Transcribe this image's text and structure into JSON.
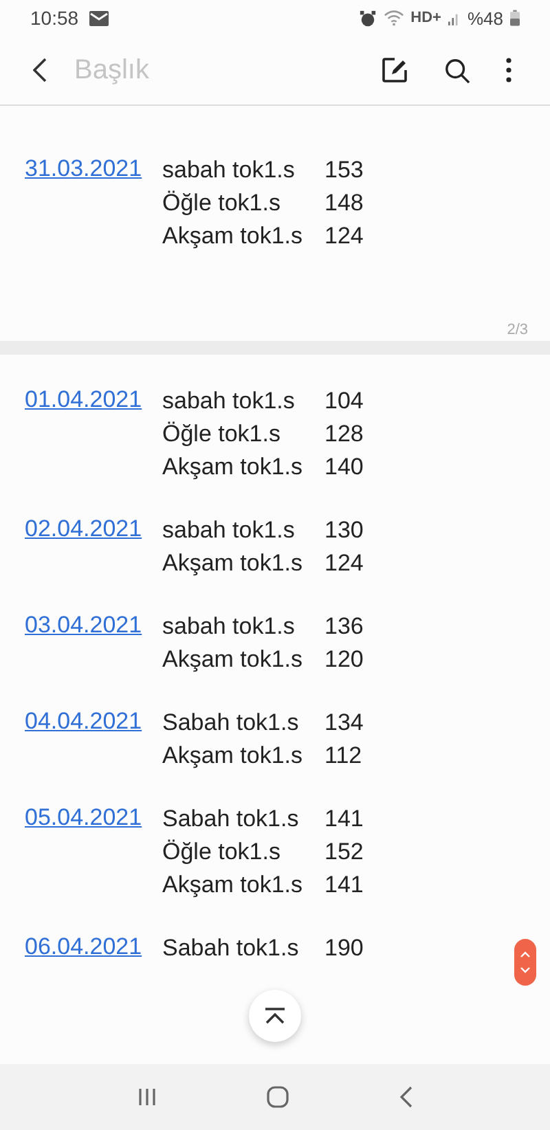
{
  "status_bar": {
    "time": "10:58",
    "network": "HD+",
    "battery": "%48"
  },
  "toolbar": {
    "title_placeholder": "Başlık"
  },
  "pages": [
    {
      "page_number": "2/3",
      "entries": [
        {
          "date": "31.03.2021",
          "lines": [
            {
              "label": "sabah tok1.s",
              "value": "153"
            },
            {
              "label": "Öğle tok1.s",
              "value": "148"
            },
            {
              "label": "Akşam tok1.s",
              "value": "124"
            }
          ]
        }
      ]
    },
    {
      "entries": [
        {
          "date": "01.04.2021",
          "lines": [
            {
              "label": "sabah tok1.s",
              "value": "104"
            },
            {
              "label": "Öğle tok1.s",
              "value": "128"
            },
            {
              "label": "Akşam tok1.s",
              "value": "140"
            }
          ]
        },
        {
          "date": "02.04.2021",
          "lines": [
            {
              "label": "sabah tok1.s",
              "value": "130"
            },
            {
              "label": "Akşam tok1.s",
              "value": "124"
            }
          ]
        },
        {
          "date": "03.04.2021",
          "lines": [
            {
              "label": "sabah tok1.s",
              "value": "136"
            },
            {
              "label": "Akşam tok1.s",
              "value": "120"
            }
          ]
        },
        {
          "date": "04.04.2021",
          "lines": [
            {
              "label": "Sabah tok1.s",
              "value": "134"
            },
            {
              "label": "Akşam tok1.s",
              "value": "112"
            }
          ]
        },
        {
          "date": "05.04.2021",
          "lines": [
            {
              "label": "Sabah tok1.s",
              "value": "141"
            },
            {
              "label": "Öğle tok1.s",
              "value": "152"
            },
            {
              "label": "Akşam tok1.s",
              "value": "141"
            }
          ]
        },
        {
          "date": "06.04.2021",
          "lines": [
            {
              "label": "Sabah tok1.s",
              "value": "190"
            }
          ]
        }
      ]
    }
  ]
}
